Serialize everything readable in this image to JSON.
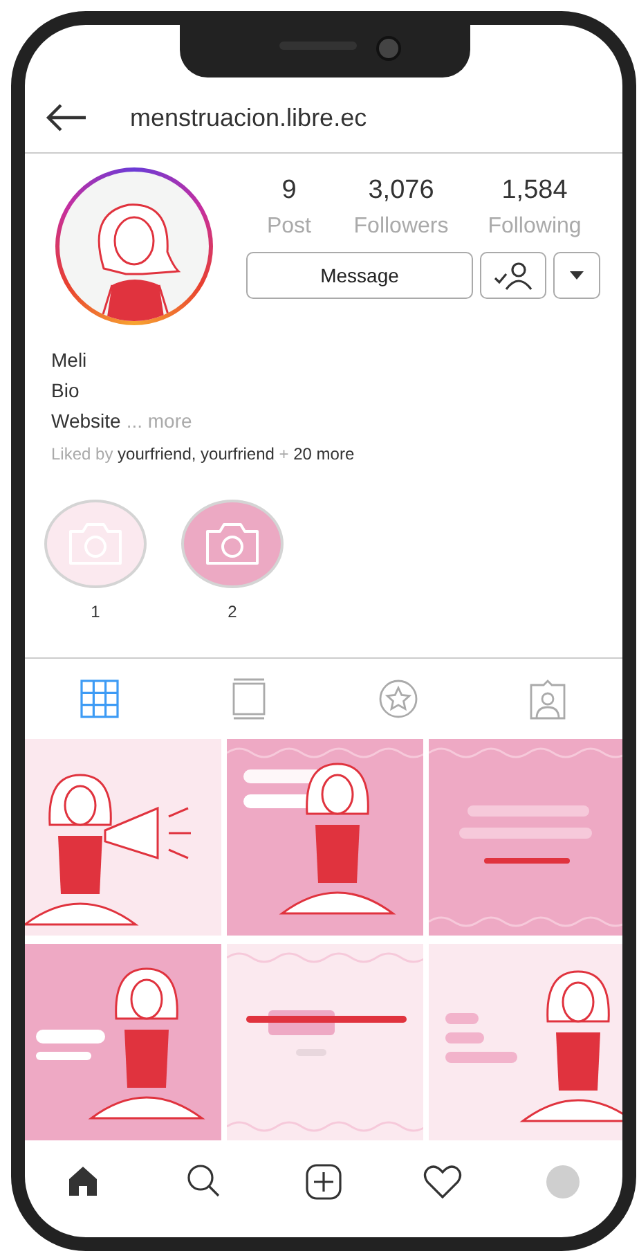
{
  "header": {
    "username": "menstruacion.libre.ec"
  },
  "profile": {
    "stats": [
      {
        "value": "9",
        "label": "Post"
      },
      {
        "value": "3,076",
        "label": "Followers"
      },
      {
        "value": "1,584",
        "label": "Following"
      }
    ],
    "message_button": "Message",
    "name": "Meli",
    "bio": "Bio",
    "website": "Website",
    "website_more": "... more",
    "liked_by": "Liked by **yourfriend, yourfriend** + **20 more**"
  },
  "highlights": [
    {
      "label": "1",
      "color": "#fbe9ef"
    },
    {
      "label": "2",
      "color": "#eca9c3"
    }
  ],
  "tabs": [
    {
      "kind": "grid",
      "selected": true
    },
    {
      "kind": "feed",
      "selected": false
    },
    {
      "kind": "star",
      "selected": false
    },
    {
      "kind": "tagged",
      "selected": false
    }
  ],
  "nav": [
    {
      "kind": "home"
    },
    {
      "kind": "search"
    },
    {
      "kind": "add"
    },
    {
      "kind": "heart"
    },
    {
      "kind": "profile"
    }
  ]
}
